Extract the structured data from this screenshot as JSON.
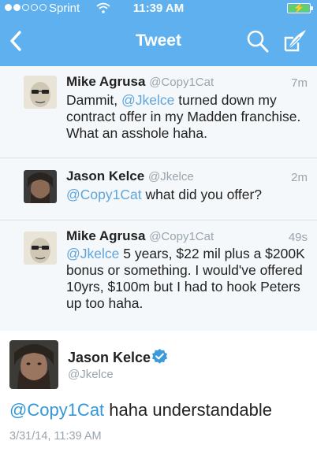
{
  "status_bar": {
    "carrier": "Sprint",
    "time": "11:39 AM",
    "battery_bolt": "⚡"
  },
  "nav": {
    "title": "Tweet",
    "back_icon": "chevron-left-icon",
    "search_icon": "search-icon",
    "compose_icon": "compose-icon"
  },
  "replies": [
    {
      "name": "Mike Agrusa",
      "handle": "@Copy1Cat",
      "age": "7m",
      "text_prefix": "Dammit, ",
      "mention": "@Jkelce",
      "text_suffix": " turned down my contract offer in my Madden franchise. What an asshole haha."
    },
    {
      "name": "Jason Kelce",
      "handle": "@Jkelce",
      "age": "2m",
      "mention": "@Copy1Cat",
      "text_suffix": " what did you offer?"
    },
    {
      "name": "Mike Agrusa",
      "handle": "@Copy1Cat",
      "age": "49s",
      "mention": "@Jkelce",
      "text_suffix": " 5 years, $22 mil plus a $200K bonus or something. I would've offered 10yrs, $100m but I had to hook Peters up too haha."
    }
  ],
  "main_tweet": {
    "name": "Jason Kelce",
    "handle": "@Jkelce",
    "mention": "@Copy1Cat",
    "text_suffix": " haha understandable",
    "timestamp": "3/31/14, 11:39 AM"
  },
  "colors": {
    "nav_bar": "#5eb1ee",
    "link": "#3597d6",
    "battery_fill": "#5fd06a"
  }
}
